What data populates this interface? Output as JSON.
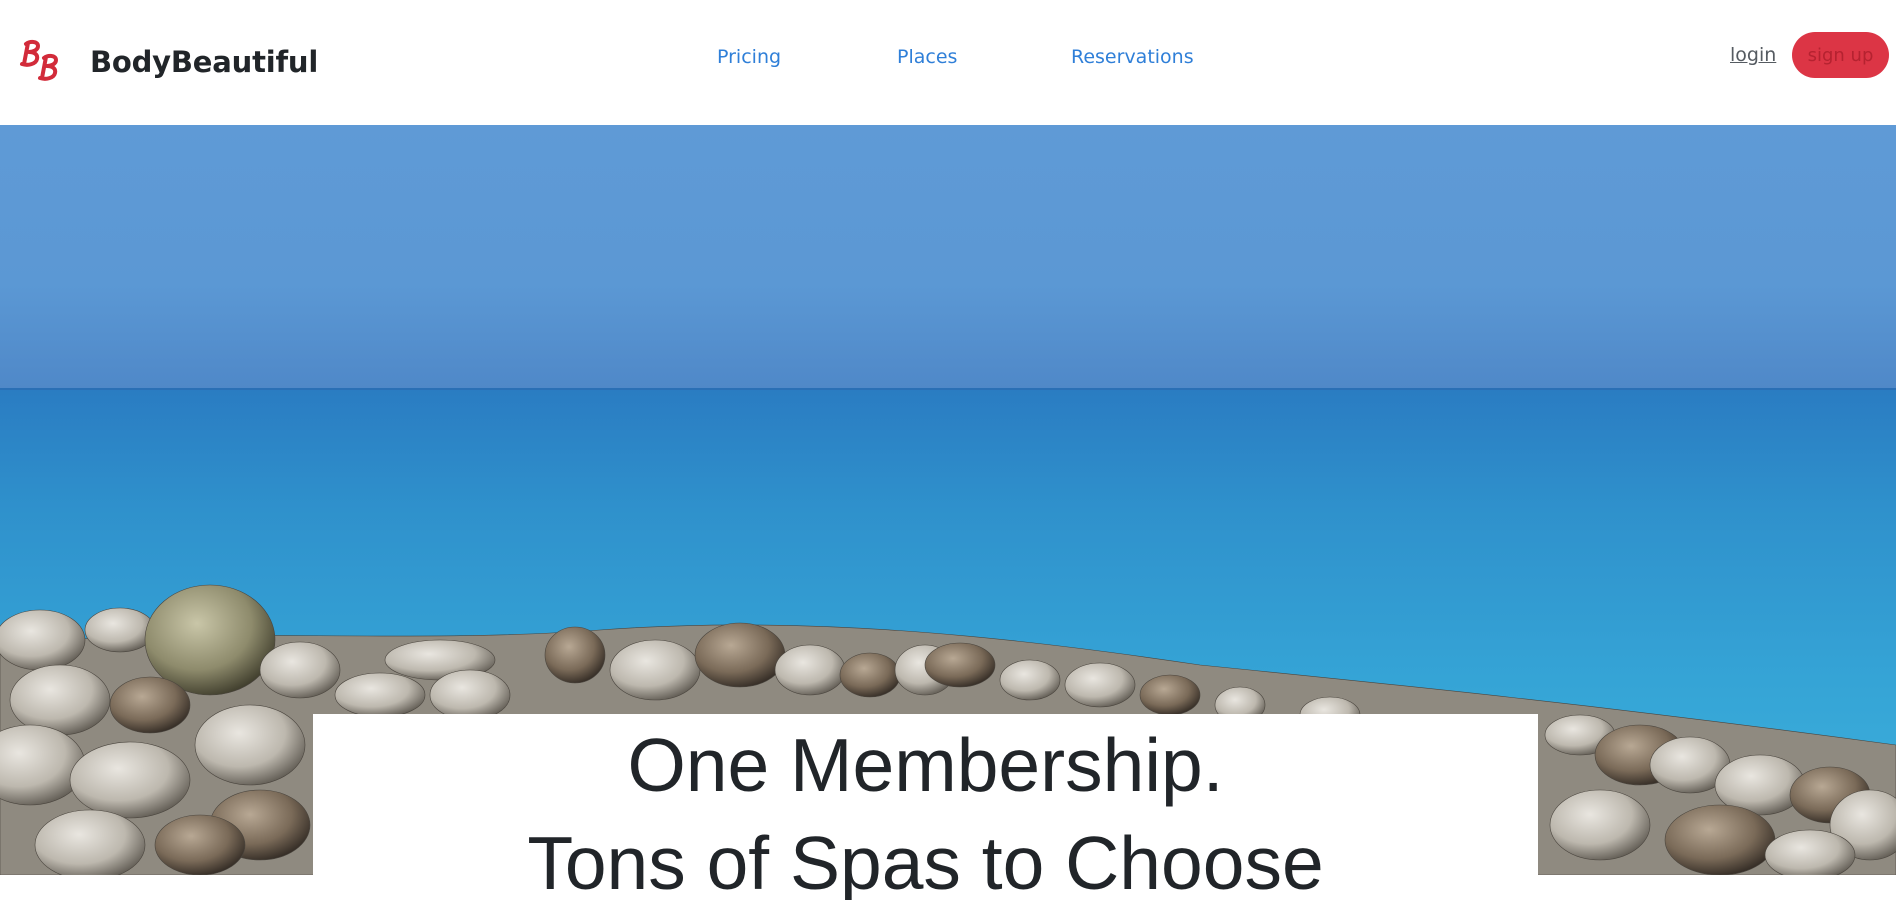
{
  "header": {
    "brand_name": "BodyBeautiful",
    "logo_icon": "bb-script-logo-icon",
    "nav": [
      {
        "label": "Pricing"
      },
      {
        "label": "Places"
      },
      {
        "label": "Reservations"
      }
    ],
    "login_label": "login",
    "signup_label": "sign up"
  },
  "hero": {
    "image_icon": "beach-pebbles-sea-image",
    "headline_line1": "One Membership.",
    "headline_line2": "Tons of Spas to Choose"
  },
  "colors": {
    "accent": "#dc3545",
    "nav_link": "#2f7fd8",
    "text": "#212529"
  }
}
